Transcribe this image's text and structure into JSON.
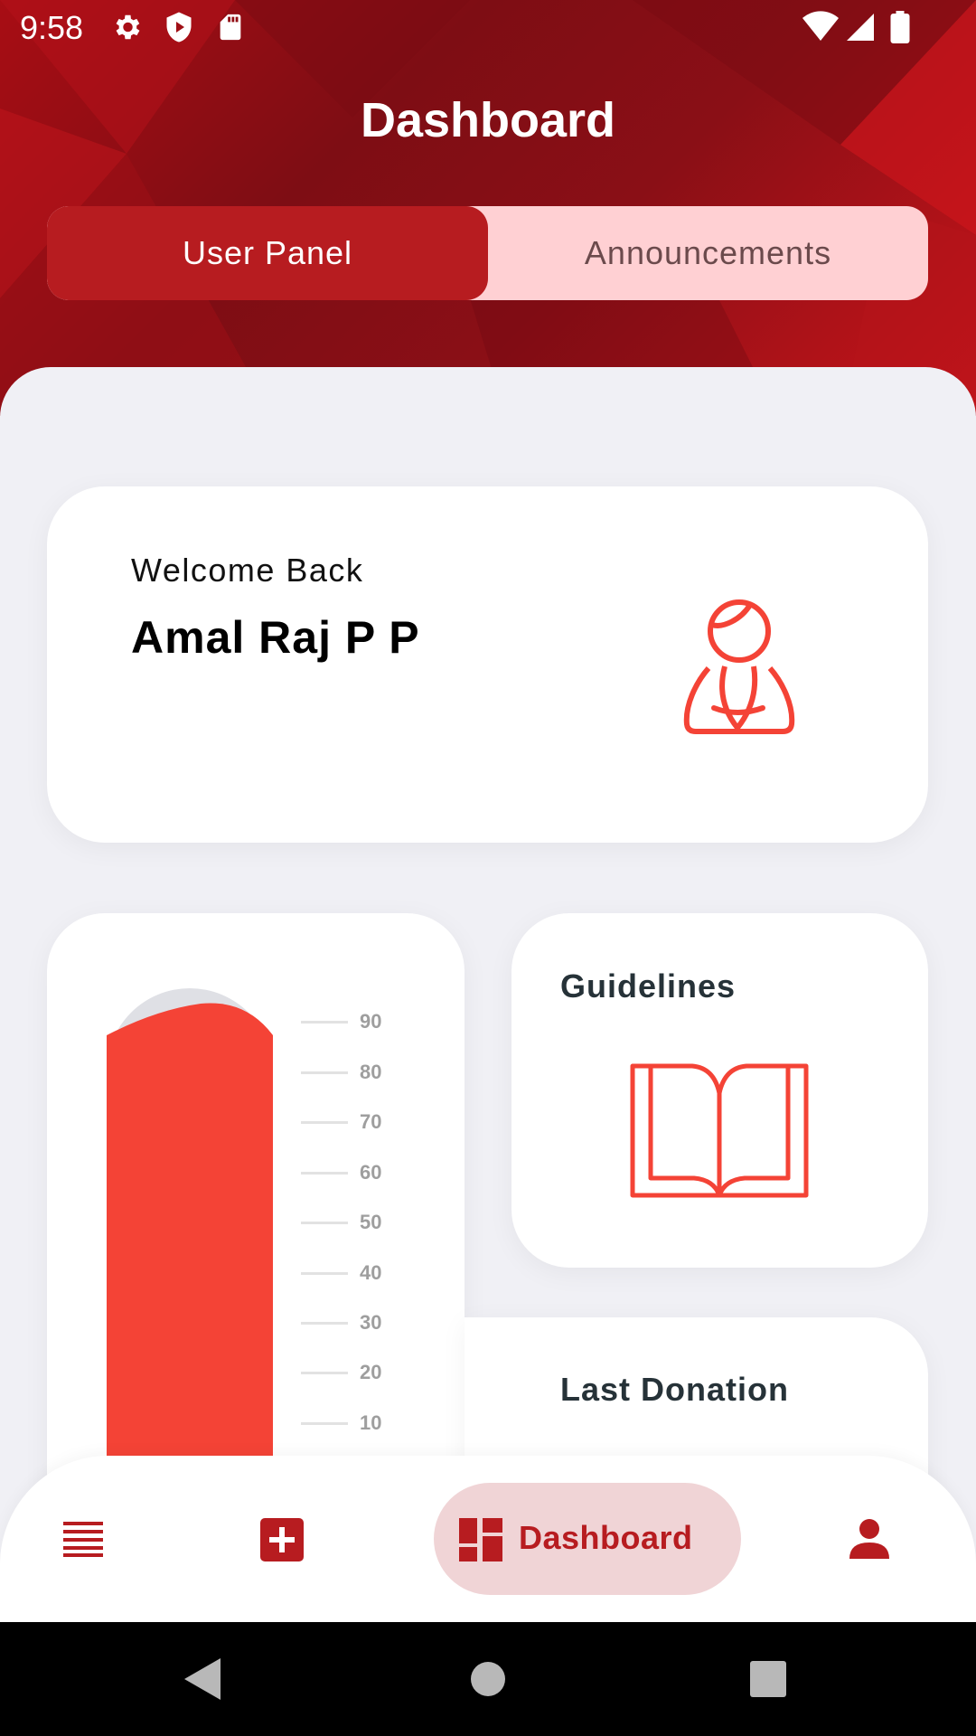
{
  "status_bar": {
    "time": "9:58",
    "icons": [
      "gear-icon",
      "shield-icon",
      "sd-card-icon",
      "wifi-icon",
      "signal-icon",
      "battery-icon"
    ]
  },
  "header": {
    "title": "Dashboard"
  },
  "tabs": [
    {
      "label": "User Panel",
      "active": true
    },
    {
      "label": "Announcements",
      "active": false
    }
  ],
  "welcome_card": {
    "greeting": "Welcome Back",
    "name": "Amal Raj P P",
    "icon": "person-namaste-icon"
  },
  "level_card": {
    "scale": [
      "90",
      "80",
      "70",
      "60",
      "50",
      "40",
      "30",
      "20",
      "10"
    ],
    "fill_percent": 95
  },
  "guidelines_card": {
    "title": "Guidelines",
    "icon": "open-book-icon"
  },
  "last_donation_card": {
    "title": "Last Donation"
  },
  "bottom_nav": {
    "items": [
      {
        "icon": "list-icon"
      },
      {
        "icon": "add-box-icon"
      },
      {
        "icon": "dashboard-icon",
        "label": "Dashboard",
        "active": true
      },
      {
        "icon": "person-icon"
      }
    ]
  },
  "system_nav": [
    "back-icon",
    "home-icon",
    "recents-icon"
  ],
  "colors": {
    "primary": "#b71c20",
    "accent_red": "#f44336",
    "tab_inactive_bg": "#ffd0d3",
    "background": "#f0f0f5",
    "nav_pill_bg": "#f0d4d6"
  }
}
